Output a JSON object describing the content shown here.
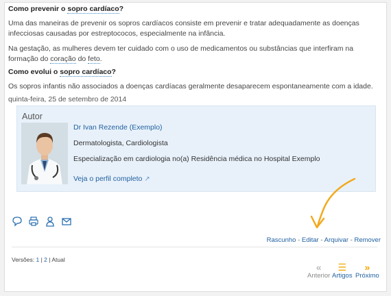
{
  "article": {
    "q1": {
      "prefix": "Como prevenir o ",
      "link": "sopro cardíaco",
      "suffix": "?"
    },
    "p1": "Uma das maneiras de prevenir os sopros cardíacos consiste em prevenir e tratar adequadamente as doenças infecciosas causadas por estreptococos, especialmente na infância.",
    "p2": {
      "a": "Na gestação, as mulheres devem ter cuidado com o uso de medicamentos ou substâncias que interfiram na formação do ",
      "link1": "coração",
      "b": " do ",
      "link2": "feto",
      "c": "."
    },
    "q2": {
      "prefix": "Como evolui o ",
      "link": "sopro cardíaco",
      "suffix": "?"
    },
    "p3": "Os sopros infantis não associados a doenças cardíacas geralmente desaparecem espontaneamente com a idade.",
    "date": "quinta-feira, 25 de setembro de 2014"
  },
  "author": {
    "box_title": "Autor",
    "name": "Dr Ivan Rezende (Exemplo)",
    "specialties": "Dermatologista, Cardiologista",
    "training": "Especialização em cardiologia no(a) Residência médica no Hospital Exemplo",
    "profile_link": "Veja o perfil completo"
  },
  "share_icons": [
    "comment-icon",
    "print-icon",
    "user-icon",
    "email-icon"
  ],
  "actions": [
    "Rascunho",
    "Editar",
    "Arquivar",
    "Remover"
  ],
  "versions": {
    "label": "Versões:",
    "v1": "1",
    "v2": "2",
    "current": "Atual"
  },
  "nav": {
    "prev": "Anterior",
    "articles": "Artigos",
    "next": "Próximo"
  },
  "colors": {
    "link": "#1f5f9f",
    "accent_arrow": "#f2a91e",
    "author_bg": "#e8f1fa"
  }
}
